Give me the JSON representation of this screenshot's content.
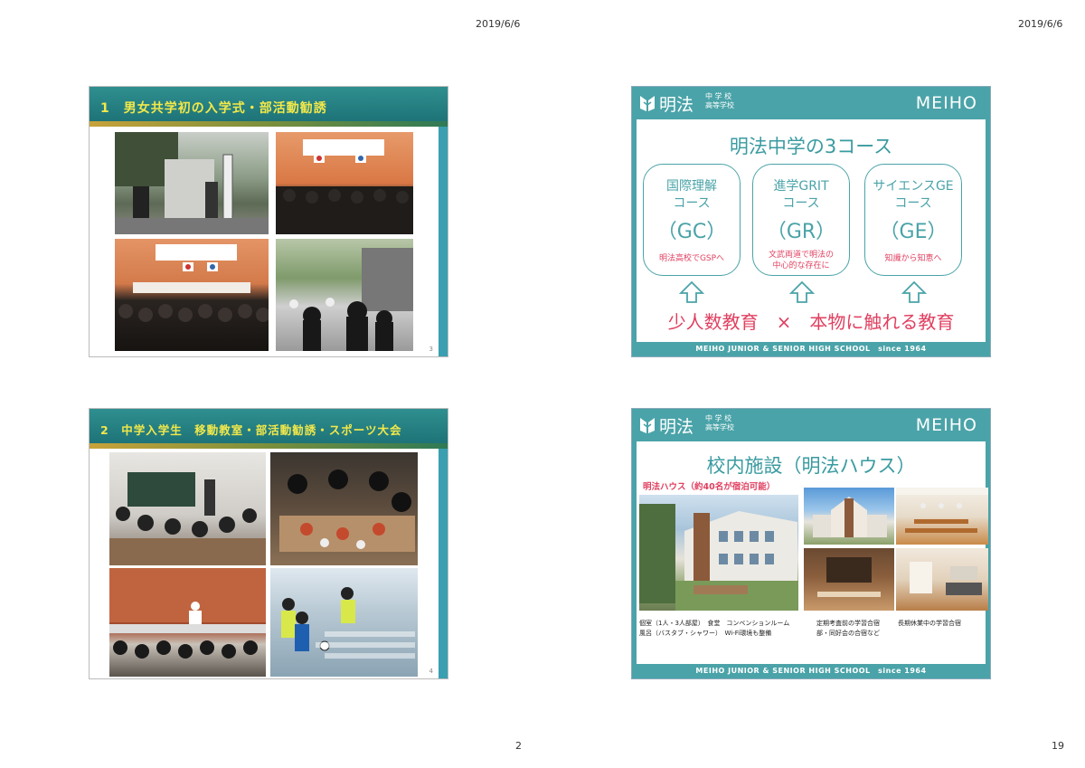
{
  "page": {
    "date_left": "2019/6/6",
    "date_right": "2019/6/6",
    "page_left": "2",
    "page_right": "19"
  },
  "slide1": {
    "title": "1　男女共学初の入学式・部活動勧誘",
    "number": "3"
  },
  "slide2": {
    "title": "2　中学入学生　移動教室・部活動勧誘・スポーツ大会",
    "number": "4"
  },
  "slide3": {
    "logo_text": "明法",
    "logo_sub1": "中 学 校",
    "logo_sub2": "高等学校",
    "brand": "MEIHO",
    "heading": "明法中学の3コース",
    "courses": [
      {
        "name1": "国際理解",
        "name2": "コース",
        "abbr": "（GC）",
        "note1": "明法高校でGSPへ",
        "note2": ""
      },
      {
        "name1": "進学GRIT",
        "name2": "コース",
        "abbr": "（GR）",
        "note1": "文武両道で明法の",
        "note2": "中心的な存在に"
      },
      {
        "name1": "サイエンスGE",
        "name2": "コース",
        "abbr": "（GE）",
        "note1": "知識から知恵へ",
        "note2": ""
      }
    ],
    "bottom_line": "少人数教育　×　本物に触れる教育",
    "footer": "MEIHO JUNIOR & SENIOR HIGH SCHOOL　since 1964"
  },
  "slide4": {
    "logo_text": "明法",
    "logo_sub1": "中 学 校",
    "logo_sub2": "高等学校",
    "brand": "MEIHO",
    "heading": "校内施設（明法ハウス）",
    "subheading": "明法ハウス（約40名が宿泊可能）",
    "caption_left1": "個室（1人・3人部屋）　食堂　コンベンションルーム",
    "caption_left2": "風呂（バスタブ・シャワー）　Wi-Fi環境も整備",
    "caption_mid1": "定期考査前の学習合宿",
    "caption_mid2": "部・同好会の合宿など",
    "caption_right1": "長期休業中の学習合宿",
    "footer": "MEIHO JUNIOR & SENIOR HIGH SCHOOL　since 1964"
  }
}
